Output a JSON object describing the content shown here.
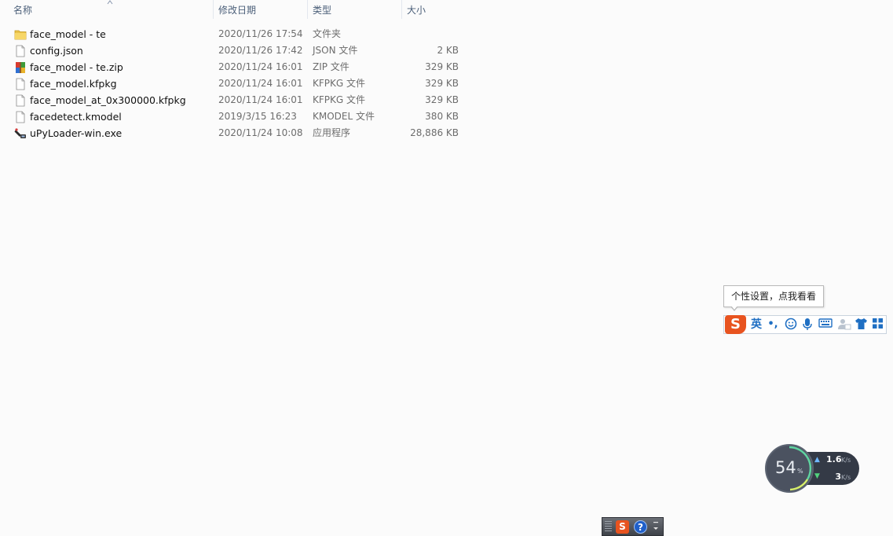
{
  "columns": {
    "name": "名称",
    "date": "修改日期",
    "type": "类型",
    "size": "大小"
  },
  "files": [
    {
      "name": "face_model - te",
      "date": "2020/11/26 17:54",
      "type": "文件夹",
      "size": "",
      "icon": "folder-icon"
    },
    {
      "name": "config.json",
      "date": "2020/11/26 17:42",
      "type": "JSON 文件",
      "size": "2 KB",
      "icon": "file-icon"
    },
    {
      "name": "face_model - te.zip",
      "date": "2020/11/24 16:01",
      "type": "ZIP 文件",
      "size": "329 KB",
      "icon": "archive-icon"
    },
    {
      "name": "face_model.kfpkg",
      "date": "2020/11/24 16:01",
      "type": "KFPKG 文件",
      "size": "329 KB",
      "icon": "file-icon"
    },
    {
      "name": "face_model_at_0x300000.kfpkg",
      "date": "2020/11/24 16:01",
      "type": "KFPKG 文件",
      "size": "329 KB",
      "icon": "file-icon"
    },
    {
      "name": "facedetect.kmodel",
      "date": "2019/3/15 16:23",
      "type": "KMODEL 文件",
      "size": "380 KB",
      "icon": "file-icon"
    },
    {
      "name": "uPyLoader-win.exe",
      "date": "2020/11/24 10:08",
      "type": "应用程序",
      "size": "28,886 KB",
      "icon": "exe-icon"
    }
  ],
  "ime": {
    "tooltip": "个性设置，点我看看",
    "logo": "S",
    "mode": "英",
    "punct": "•,"
  },
  "meter": {
    "percent": "54",
    "percent_symbol": "%",
    "upload": "1.6",
    "download": "3",
    "unit": "K/s"
  },
  "tray": {
    "logo": "S",
    "help": "?"
  },
  "colors": {
    "accent": "#1f6fc3",
    "ime_logo": "#e8531f",
    "meter_bg": "#343a46"
  }
}
